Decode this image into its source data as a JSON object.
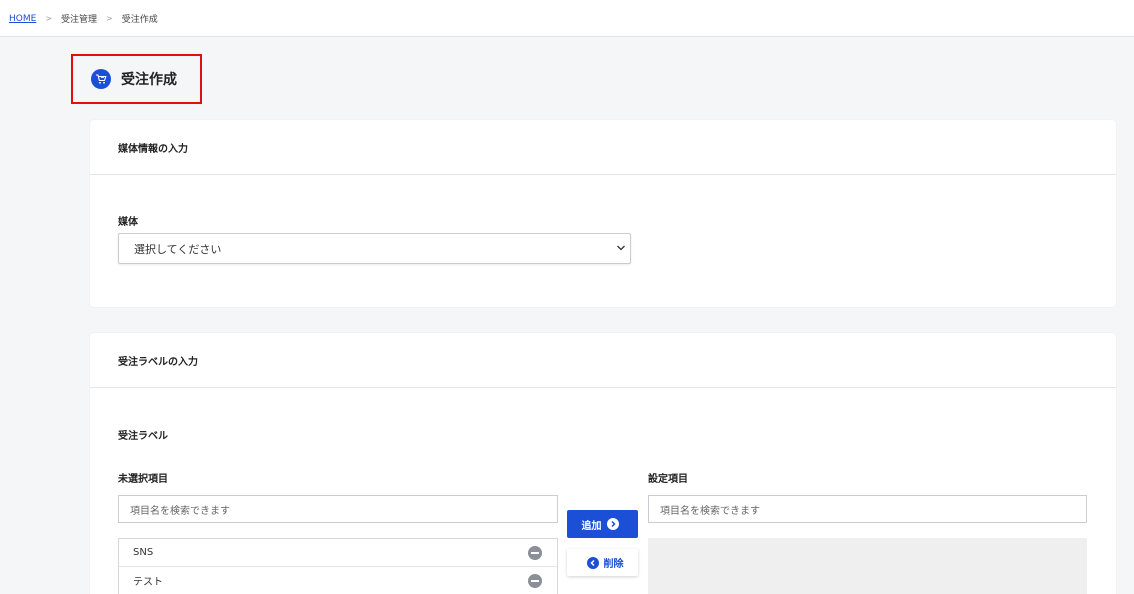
{
  "breadcrumb": {
    "home": "HOME",
    "sep": ">",
    "section": "受注管理",
    "current": "受注作成"
  },
  "page": {
    "title": "受注作成"
  },
  "media_card": {
    "header": "媒体情報の入力",
    "field_label": "媒体",
    "select_value": "選択してください"
  },
  "label_card": {
    "header": "受注ラベルの入力",
    "section_label": "受注ラベル",
    "unselected_label": "未選択項目",
    "selected_label": "設定項目",
    "search_placeholder_left": "項目名を検索できます",
    "search_placeholder_right": "項目名を検索できます",
    "add_button": "追加",
    "delete_button": "削除",
    "items": [
      "SNS",
      "テスト"
    ]
  },
  "colors": {
    "accent": "#1a4fd6",
    "highlight_border": "#e01010"
  }
}
